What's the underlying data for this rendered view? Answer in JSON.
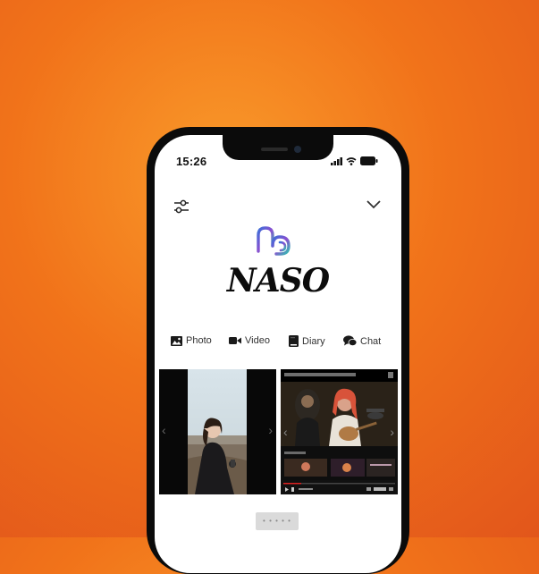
{
  "status_bar": {
    "time": "15:26"
  },
  "app": {
    "name": "NASO",
    "logo_text": "nb"
  },
  "tabs": [
    {
      "label": "Photo",
      "icon": "photo-icon"
    },
    {
      "label": "Video",
      "icon": "video-icon"
    },
    {
      "label": "Diary",
      "icon": "diary-icon"
    },
    {
      "label": "Chat",
      "icon": "chat-icon"
    }
  ],
  "carousel": {
    "prev": "‹",
    "next": "›"
  },
  "pagination": {
    "label": "• • • • •"
  },
  "colors": {
    "accent_blue": "#3b6fd8",
    "accent_purple": "#8b4fd0",
    "accent_teal": "#2fc2b0"
  }
}
